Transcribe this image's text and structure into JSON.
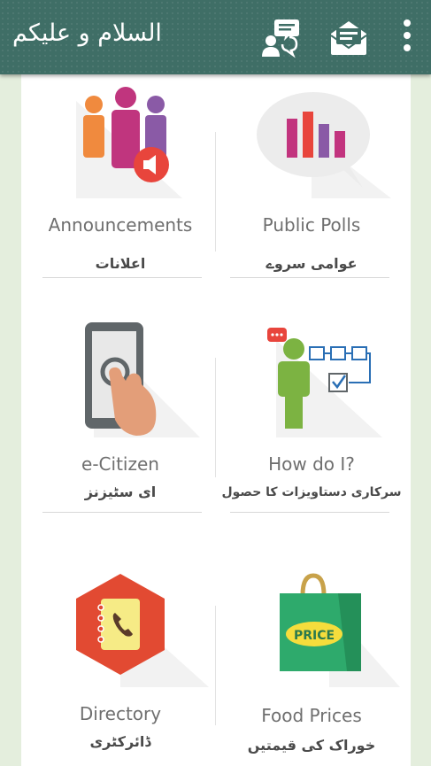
{
  "appbar": {
    "greeting": "السلام و علیکم",
    "icons": [
      "chat-people-icon",
      "feedback-mail-icon",
      "more-vert-icon"
    ]
  },
  "tiles": [
    {
      "title": "Announcements",
      "subtitle": "اعلانات",
      "icon": "people-megaphone-icon"
    },
    {
      "title": "Public Polls",
      "subtitle": "عوامی سروے",
      "icon": "bar-chart-bubble-icon"
    },
    {
      "title": "e-Citizen",
      "subtitle": "ای سٹیزنز",
      "icon": "phone-tap-icon"
    },
    {
      "title": "How do I?",
      "subtitle": "سرکاری دستاویزات کا حصول",
      "icon": "steps-checklist-icon"
    },
    {
      "title": "Directory",
      "subtitle": "ڈائرکٹری",
      "icon": "phonebook-icon"
    },
    {
      "title": "Food Prices",
      "subtitle": "خوراک کی قیمتیں",
      "icon": "shopping-bag-price-icon",
      "badge": "PRICE"
    }
  ],
  "colors": {
    "appbar": "#3f6e66",
    "background": "#e4eedd",
    "panel": "#ffffff"
  }
}
